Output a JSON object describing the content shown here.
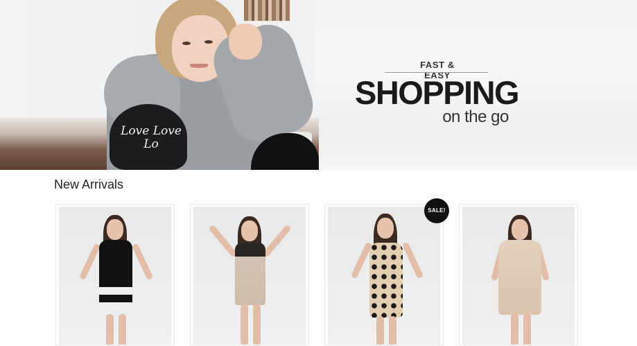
{
  "hero": {
    "tagline_small": "FAST & EASY",
    "tagline_big": "SHOPPING",
    "tagline_sub": "on the go",
    "hoodie_print": "Love Love Lo"
  },
  "new_arrivals": {
    "title": "New Arrivals",
    "products": [
      {
        "name": "Black and white sleeveless dress",
        "badge": ""
      },
      {
        "name": "Beige striped bodycon dress",
        "badge": ""
      },
      {
        "name": "Polka dot sleeveless dress",
        "badge": "SALE!"
      },
      {
        "name": "Beige short-sleeve dress",
        "badge": ""
      }
    ]
  },
  "colors": {
    "accent": "#111111",
    "text": "#222222",
    "background": "#ffffff"
  }
}
